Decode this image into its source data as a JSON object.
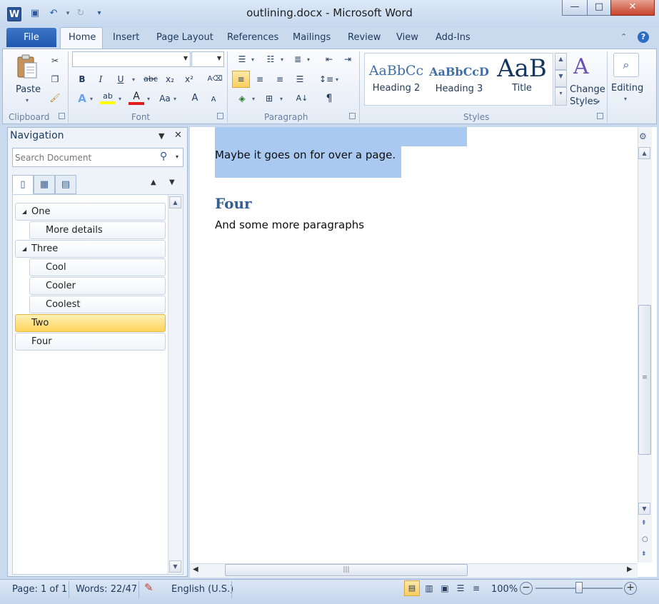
{
  "window": {
    "title": "outlining.docx - Microsoft Word",
    "app_icon_letter": "W",
    "controls": {
      "minimize": "—",
      "maximize": "□",
      "close": "✕"
    }
  },
  "qat": {
    "save_glyph": "💾",
    "undo_glyph": "↶",
    "redo_glyph": "↻",
    "customize_glyph": "▾"
  },
  "ribbon": {
    "tabs": [
      {
        "label": "File",
        "active": false
      },
      {
        "label": "Home",
        "active": true
      },
      {
        "label": "Insert",
        "active": false
      },
      {
        "label": "Page Layout",
        "active": false
      },
      {
        "label": "References",
        "active": false
      },
      {
        "label": "Mailings",
        "active": false
      },
      {
        "label": "Review",
        "active": false
      },
      {
        "label": "View",
        "active": false
      },
      {
        "label": "Add-Ins",
        "active": false
      }
    ],
    "groups": {
      "clipboard": {
        "label": "Clipboard",
        "paste_label": "Paste"
      },
      "font": {
        "label": "Font",
        "font_name": "",
        "font_size": "",
        "bold": "B",
        "italic": "I",
        "underline": "U",
        "strike": "abc",
        "subscript": "x₂",
        "superscript": "x²",
        "change_case": "Aa",
        "grow": "A",
        "shrink": "A"
      },
      "paragraph": {
        "label": "Paragraph",
        "show_marks": "¶"
      },
      "styles": {
        "label": "Styles",
        "gallery": [
          {
            "sample": "AaBbCc",
            "name": "Heading 2"
          },
          {
            "sample": "AaBbCcD",
            "name": "Heading 3"
          },
          {
            "sample": "AaB",
            "name": "Title"
          }
        ],
        "change_styles_line1": "Change",
        "change_styles_line2": "Styles"
      },
      "editing": {
        "label": "Editing"
      }
    }
  },
  "navigation": {
    "title": "Navigation",
    "search_placeholder": "Search Document",
    "headings": [
      {
        "label": "One",
        "level": 1,
        "expandable": true,
        "active": false
      },
      {
        "label": "More details",
        "level": 2,
        "expandable": false,
        "active": false
      },
      {
        "label": "Three",
        "level": 1,
        "expandable": true,
        "active": false
      },
      {
        "label": "Cool",
        "level": 2,
        "expandable": false,
        "active": false
      },
      {
        "label": "Cooler",
        "level": 2,
        "expandable": false,
        "active": false
      },
      {
        "label": "Coolest",
        "level": 2,
        "expandable": false,
        "active": false
      },
      {
        "label": "Two",
        "level": 1,
        "expandable": false,
        "active": true
      },
      {
        "label": "Four",
        "level": 1,
        "expandable": false,
        "active": false
      }
    ]
  },
  "document": {
    "selected_paragraph": "Maybe it goes on for over a page.",
    "heading": "Four",
    "body_paragraph": "And some more paragraphs"
  },
  "statusbar": {
    "page": "Page: 1 of 1",
    "words": "Words: 22/47",
    "language": "English (U.S.)",
    "zoom": "100%",
    "zoom_level_percent": 100
  },
  "colors": {
    "accent": "#2b579a",
    "selection": "#a9c9f1",
    "active_heading": "#ffd45a",
    "heading_text": "#365f91"
  }
}
